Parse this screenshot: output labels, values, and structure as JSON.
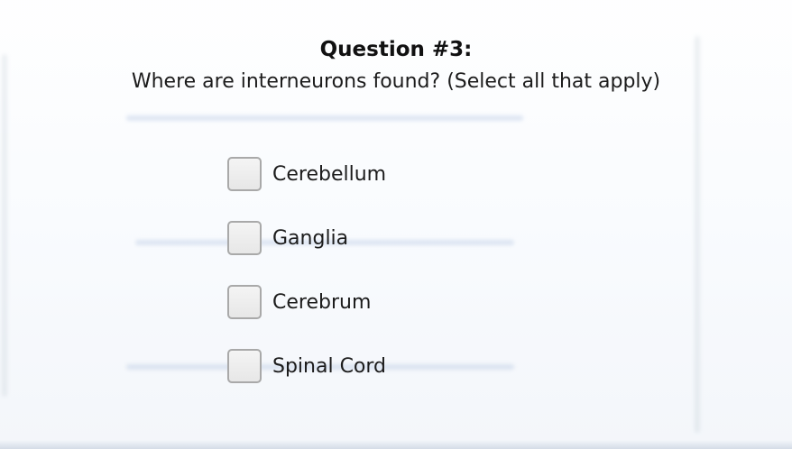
{
  "question": {
    "title": "Question #3:",
    "text": "Where are interneurons found? (Select all that apply)"
  },
  "options": [
    {
      "label": "Cerebellum",
      "checked": false
    },
    {
      "label": "Ganglia",
      "checked": false
    },
    {
      "label": "Cerebrum",
      "checked": false
    },
    {
      "label": "Spinal Cord",
      "checked": false
    }
  ],
  "colors": {
    "checkbox_border": "#a9a9a9",
    "checkbox_fill": "#ededed",
    "text": "#1c1c1c"
  }
}
